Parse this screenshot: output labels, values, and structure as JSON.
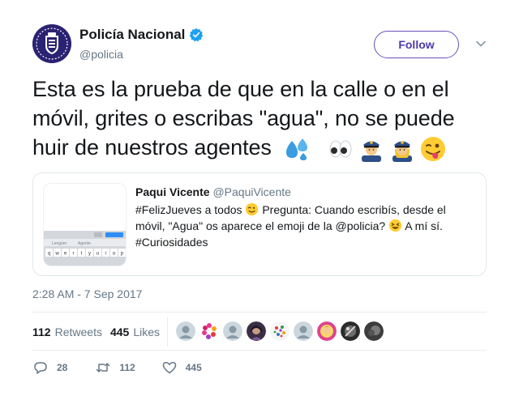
{
  "author": {
    "name": "Policía Nacional",
    "handle": "@policia",
    "verified": true
  },
  "follow_label": "Follow",
  "tweet": {
    "text": "Esta es la prueba de que en la calle o en el móvil, grites o escribas \"agua\", no se puede huir de nuestros agentes",
    "emojis": [
      "sweat-droplets",
      "eyes",
      "police-officer-man",
      "police-officer-woman",
      "winking-face-with-tongue"
    ]
  },
  "quoted": {
    "name": "Paqui Vicente",
    "handle": "@PaquiVicente",
    "line1": "#FelizJueves a todos",
    "line1_b": "Pregunta: Cuando escribís, desde el",
    "line2": "móvil, \"Agua\" os aparece el emoji de la @policia?",
    "line2_b": "A mí sí.",
    "line3": "#Curiosidades",
    "thumb_keys": [
      "q",
      "w",
      "e",
      "r",
      "t",
      "y",
      "u",
      "i",
      "o",
      "p"
    ],
    "thumb_suggestions": [
      "Lengüer",
      "Agente"
    ]
  },
  "timestamp": "2:28 AM - 7 Sep 2017",
  "stats": {
    "retweets_count": "112",
    "retweets_label": "Retweets",
    "likes_count": "445",
    "likes_label": "Likes"
  },
  "actions": {
    "reply_count": "28",
    "retweet_count": "112",
    "like_count": "445"
  },
  "colors": {
    "follow_border": "#6b4fbb",
    "verified": "#1da1f2",
    "muted": "#657786"
  }
}
